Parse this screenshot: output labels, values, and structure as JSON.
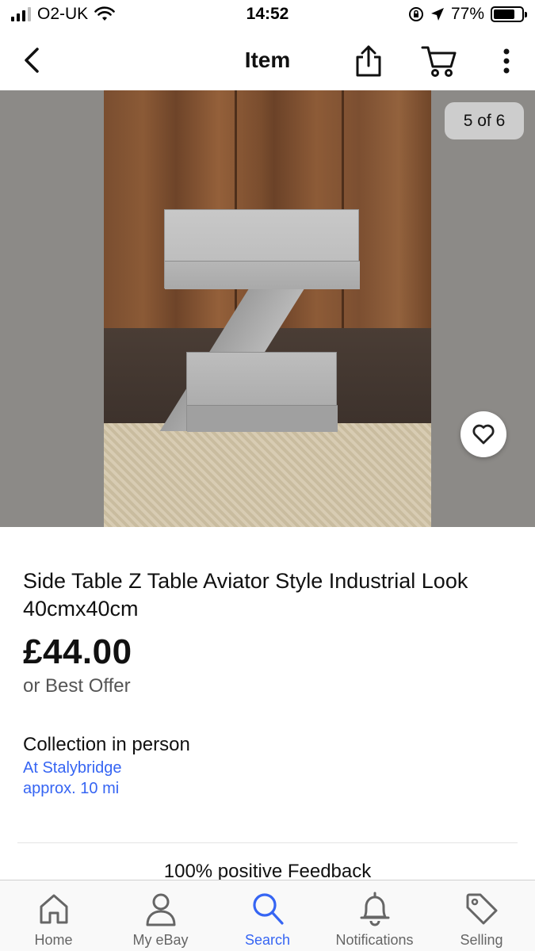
{
  "status_bar": {
    "carrier": "O2-UK",
    "time": "14:52",
    "battery_percent_label": "77%",
    "battery_level": 0.77
  },
  "nav": {
    "title": "Item"
  },
  "gallery": {
    "counter": "5 of 6"
  },
  "item": {
    "title": "Side Table Z Table Aviator Style Industrial Look 40cmx40cm",
    "price": "£44.00",
    "offer": "or Best Offer",
    "delivery_title": "Collection in person",
    "location_line1": "At Stalybridge",
    "location_line2": "approx. 10 mi"
  },
  "seller": {
    "feedback": "100% positive Feedback"
  },
  "tabs": [
    {
      "label": "Home",
      "icon": "home-icon"
    },
    {
      "label": "My eBay",
      "icon": "person-icon"
    },
    {
      "label": "Search",
      "icon": "search-icon",
      "active": true
    },
    {
      "label": "Notifications",
      "icon": "bell-icon"
    },
    {
      "label": "Selling",
      "icon": "tag-icon"
    }
  ],
  "colors": {
    "accent": "#3665f3",
    "link": "#3665f3",
    "gallery_bg": "#8c8a87"
  }
}
